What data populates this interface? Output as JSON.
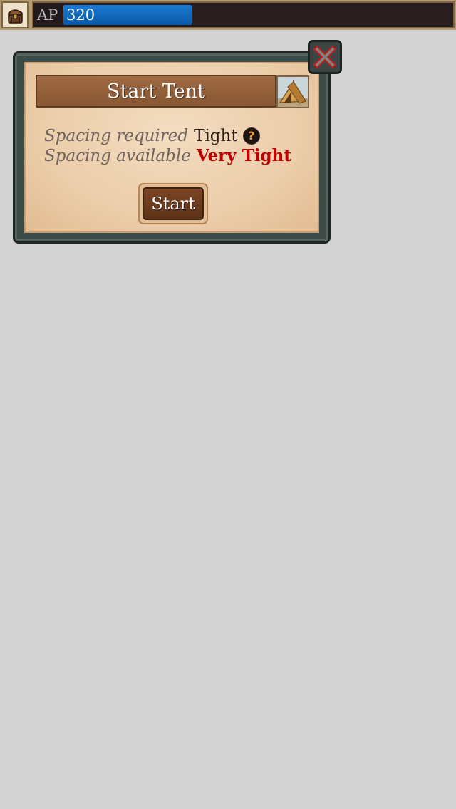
{
  "topbar": {
    "inventory_icon": "chest-icon",
    "ap_label": "AP",
    "ap_value": "320",
    "ap_fill_fraction": 0.33,
    "ap_color": "#0a6ac0"
  },
  "dialog": {
    "title": "Start Tent",
    "thumbnail_icon": "tent-icon",
    "spacing_required_label": "Spacing required",
    "spacing_required_value": "Tight",
    "spacing_available_label": "Spacing available",
    "spacing_available_value": "Very Tight",
    "spacing_available_color": "#c00000",
    "help_icon": "question-icon",
    "start_label": "Start",
    "close_icon": "close-icon"
  }
}
